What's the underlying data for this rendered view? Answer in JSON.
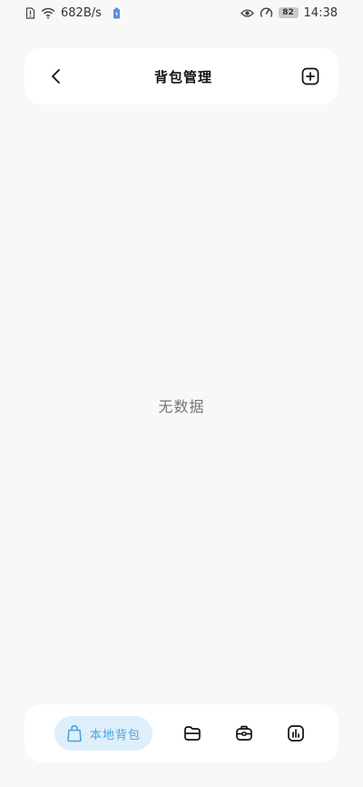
{
  "status_bar": {
    "network_speed": "682B/s",
    "battery_level": "82",
    "time": "14:38",
    "icons": [
      "sim-alert-icon",
      "wifi-icon",
      "battery-saver-icon",
      "eye-icon",
      "speed-gauge-icon",
      "battery-icon"
    ]
  },
  "header": {
    "title": "背包管理",
    "back_icon": "chevron-left-icon",
    "action_icon": "add-square-icon"
  },
  "main": {
    "empty_text": "无数据"
  },
  "bottom_nav": {
    "active_label": "本地背包",
    "items": [
      {
        "icon": "bag-icon",
        "label": "本地背包",
        "active": true
      },
      {
        "icon": "folder-icon",
        "active": false
      },
      {
        "icon": "cloud-bag-icon",
        "active": false
      },
      {
        "icon": "stats-icon",
        "active": false
      }
    ]
  },
  "colors": {
    "background": "#f8f8f8",
    "card": "#ffffff",
    "accent": "#4ba3d9",
    "accent_bg": "#deeffb"
  }
}
